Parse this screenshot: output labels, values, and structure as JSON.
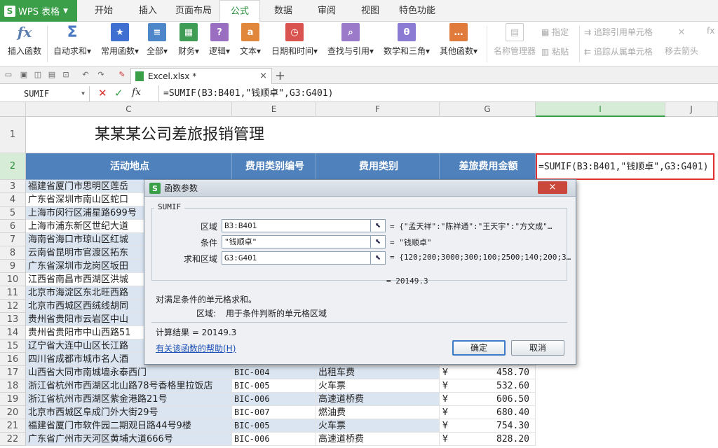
{
  "app": {
    "logo": "WPS 表格"
  },
  "menu_tabs": [
    "开始",
    "插入",
    "页面布局",
    "公式",
    "数据",
    "审阅",
    "视图",
    "特色功能"
  ],
  "active_tab": "公式",
  "ribbon": {
    "buttons": [
      "插入函数",
      "自动求和",
      "常用函数",
      "全部",
      "财务",
      "逻辑",
      "文本",
      "日期和时间",
      "查找与引用",
      "数学和三角",
      "其他函数",
      "名称管理器"
    ],
    "small": [
      "指定",
      "粘贴",
      "追踪引用单元格",
      "追踪从属单元格",
      "移去箭头"
    ],
    "colors": [
      "#5b7fb0",
      "#4a79c2",
      "#3f6fd1",
      "#4d86c9",
      "#3f9c54",
      "#9a6fc1",
      "#e0873b",
      "#d9534f",
      "#9b7bc9",
      "#8c7bd3",
      "#e07b3b"
    ]
  },
  "doc_tab": {
    "name": "Excel.xlsx *"
  },
  "formula_bar": {
    "name_box": "SUMIF",
    "formula": "=SUMIF(B3:B401,\"钱顺卓\",G3:G401)"
  },
  "columns": [
    "C",
    "E",
    "F",
    "G",
    "I",
    "J"
  ],
  "sheet": {
    "title": "某某某公司差旅报销管理",
    "headers": [
      "活动地点",
      "费用类别编号",
      "费用类别",
      "差旅费用金额"
    ],
    "cell_i2": "=SUMIF(B3:B401,\"钱顺卓\",G3:G401)",
    "rows": [
      {
        "n": "3",
        "place": "福建省厦门市思明区莲岳",
        "code": "",
        "cat": "",
        "cur": "",
        "amt": ""
      },
      {
        "n": "4",
        "place": "广东省深圳市南山区蛇口",
        "code": "",
        "cat": "",
        "cur": "",
        "amt": ""
      },
      {
        "n": "5",
        "place": "上海市闵行区浦星路699号",
        "code": "",
        "cat": "",
        "cur": "",
        "amt": ""
      },
      {
        "n": "6",
        "place": "上海市浦东新区世纪大道",
        "code": "",
        "cat": "",
        "cur": "",
        "amt": ""
      },
      {
        "n": "7",
        "place": "海南省海口市琼山区红城",
        "code": "",
        "cat": "",
        "cur": "",
        "amt": ""
      },
      {
        "n": "8",
        "place": "云南省昆明市官渡区拓东",
        "code": "",
        "cat": "",
        "cur": "",
        "amt": ""
      },
      {
        "n": "9",
        "place": "广东省深圳市龙岗区坂田",
        "code": "",
        "cat": "",
        "cur": "",
        "amt": ""
      },
      {
        "n": "10",
        "place": "江西省南昌市西湖区洪城",
        "code": "",
        "cat": "",
        "cur": "",
        "amt": ""
      },
      {
        "n": "11",
        "place": "北京市海淀区东北旺西路",
        "code": "",
        "cat": "",
        "cur": "",
        "amt": ""
      },
      {
        "n": "12",
        "place": "北京市西城区西绒线胡同",
        "code": "",
        "cat": "",
        "cur": "",
        "amt": ""
      },
      {
        "n": "13",
        "place": "贵州省贵阳市云岩区中山",
        "code": "",
        "cat": "",
        "cur": "",
        "amt": ""
      },
      {
        "n": "14",
        "place": "贵州省贵阳市中山西路51",
        "code": "",
        "cat": "",
        "cur": "",
        "amt": ""
      },
      {
        "n": "15",
        "place": "辽宁省大连中山区长江路",
        "code": "",
        "cat": "",
        "cur": "",
        "amt": ""
      },
      {
        "n": "16",
        "place": "四川省成都市城市名人酒",
        "code": "",
        "cat": "",
        "cur": "",
        "amt": ""
      },
      {
        "n": "17",
        "place": "山西省大同市南城墙永泰西门",
        "code": "BIC-004",
        "cat": "出租车费",
        "cur": "¥",
        "amt": "458.70"
      },
      {
        "n": "18",
        "place": "浙江省杭州市西湖区北山路78号香格里拉饭店",
        "code": "BIC-005",
        "cat": "火车票",
        "cur": "¥",
        "amt": "532.60"
      },
      {
        "n": "19",
        "place": "浙江省杭州市西湖区紫金港路21号",
        "code": "BIC-006",
        "cat": "高速道桥费",
        "cur": "¥",
        "amt": "606.50"
      },
      {
        "n": "20",
        "place": "北京市西城区阜成门外大街29号",
        "code": "BIC-007",
        "cat": "燃油费",
        "cur": "¥",
        "amt": "680.40"
      },
      {
        "n": "21",
        "place": "福建省厦门市软件园二期观日路44号9楼",
        "code": "BIC-005",
        "cat": "火车票",
        "cur": "¥",
        "amt": "754.30"
      },
      {
        "n": "22",
        "place": "广东省广州市天河区黄埔大道666号",
        "code": "BIC-006",
        "cat": "高速道桥费",
        "cur": "¥",
        "amt": "828.20"
      }
    ]
  },
  "dialog": {
    "title": "函数参数",
    "close": "×",
    "func": "SUMIF",
    "args": [
      {
        "label": "区域",
        "value": "B3:B401",
        "result": "= {\"孟天祥\":\"陈祥通\":\"王天宇\":\"方文成\"…"
      },
      {
        "label": "条件",
        "value": "\"钱顺卓\"",
        "result": "= \"钱顺卓\""
      },
      {
        "label": "求和区域",
        "value": "G3:G401",
        "result": "= {120;200;3000;300;100;2500;140;200;3…"
      }
    ],
    "eq_result": "= 20149.3",
    "desc": "对满足条件的单元格求和。",
    "arg_desc_label": "区域:",
    "arg_desc": "用于条件判断的单元格区域",
    "calc_result": "计算结果 = 20149.3",
    "help": "有关该函数的帮助(H)",
    "ok": "确定",
    "cancel": "取消"
  }
}
